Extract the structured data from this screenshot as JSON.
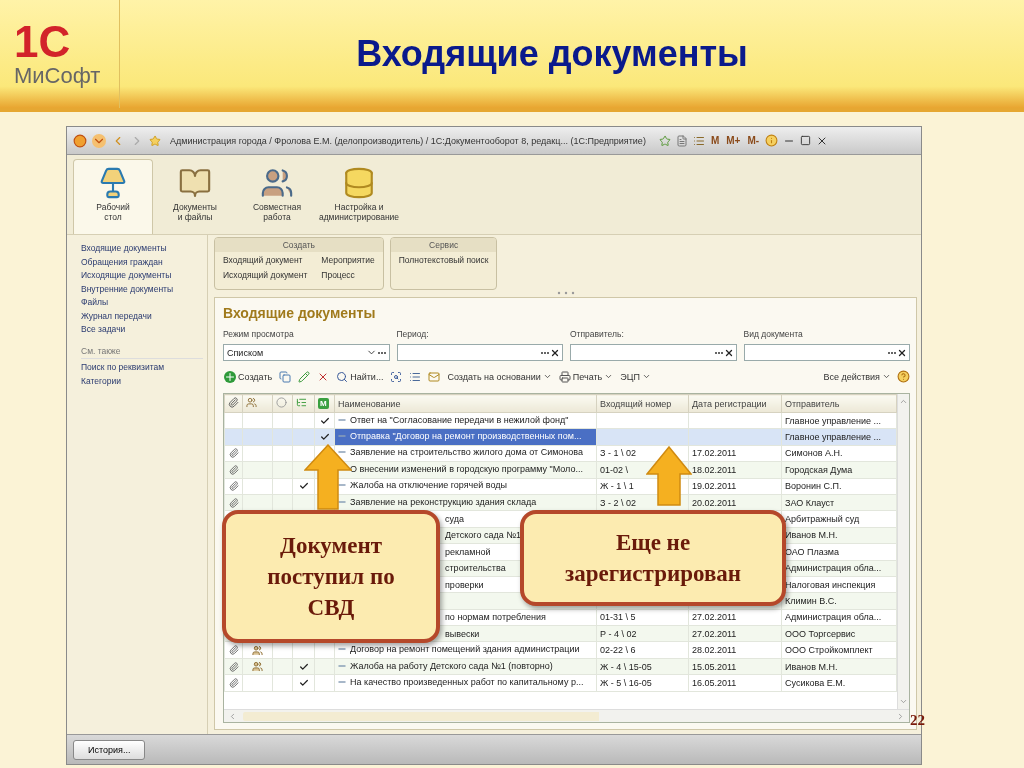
{
  "slide": {
    "logo_mark": "1С",
    "logo_brand": "МиСофт",
    "title": "Входящие документы",
    "page_number": "22"
  },
  "window": {
    "title": "Администрация города / Фролова Е.М. (делопроизводитель) / 1С:Документооборот 8, редакц... (1С:Предприятие)",
    "memory_buttons": [
      "M",
      "M+",
      "M-"
    ]
  },
  "sections": [
    {
      "label": "Рабочий\nстол",
      "kind": "desk",
      "selected": true
    },
    {
      "label": "Документы\nи файлы",
      "kind": "folder",
      "selected": false
    },
    {
      "label": "Совместная\nработа",
      "kind": "people",
      "selected": false
    },
    {
      "label": "Настройка и\nадминистрирование",
      "kind": "database",
      "selected": false
    }
  ],
  "sidebar": {
    "items": [
      "Входящие документы",
      "Обращения граждан",
      "Исходящие документы",
      "Внутренние документы",
      "Файлы",
      "Журнал передачи",
      "Все задачи"
    ],
    "see_also_title": "См. также",
    "see_also": [
      "Поиск по реквизитам",
      "Категории"
    ]
  },
  "command_groups": [
    {
      "title": "Создать",
      "columns": [
        [
          "Входящий документ",
          "Исходящий документ"
        ],
        [
          "Мероприятие",
          "Процесс"
        ]
      ]
    },
    {
      "title": "Сервис",
      "columns": [
        [
          "Полнотекстовый поиск"
        ]
      ]
    }
  ],
  "form": {
    "title": "Входящие документы",
    "filters": [
      {
        "label": "Режим просмотра",
        "value": "Списком",
        "kind": "dropdown"
      },
      {
        "label": "Период:",
        "kind": "choice"
      },
      {
        "label": "Отправитель:",
        "kind": "choice"
      },
      {
        "label": "Вид документа",
        "kind": "choice"
      }
    ],
    "toolbar": [
      {
        "kind": "plus",
        "label": "Создать",
        "dropdown": false
      },
      {
        "kind": "copy",
        "dropdown": false
      },
      {
        "kind": "pencil",
        "dropdown": false
      },
      {
        "kind": "delete",
        "dropdown": false
      },
      {
        "kind": "search",
        "label": "Найти...",
        "dropdown": false
      },
      {
        "kind": "search-list",
        "dropdown": false
      },
      {
        "kind": "list",
        "dropdown": false
      },
      {
        "kind": "mail",
        "dropdown": false
      },
      {
        "kind": "text",
        "label": "Создать на основании",
        "dropdown": true
      },
      {
        "kind": "printer",
        "label": "Печать",
        "dropdown": true
      },
      {
        "kind": "text",
        "label": "ЭЦП",
        "dropdown": true
      }
    ],
    "all_actions": "Все действия",
    "table": {
      "m_header": "M",
      "columns": [
        "Наименование",
        "Входящий номер",
        "Дата регистрации",
        "Отправитель"
      ],
      "rows": [
        {
          "kind": "full",
          "name": "Ответ на \"Согласование передачи в нежилой фонд\"",
          "sender": "Главное управление ...",
          "attached": false,
          "group": false,
          "checked": false,
          "m_checked": true,
          "selected": false
        },
        {
          "kind": "full",
          "name": "Отправка \"Договор на ремонт производственных пом...",
          "sender": "Главное управление ...",
          "attached": false,
          "group": false,
          "checked": false,
          "m_checked": true,
          "selected": true
        },
        {
          "kind": "full",
          "name": "Заявление на строительство жилого дома от Симонова",
          "number": "З - 1 \\ 02",
          "date": "17.02.2011",
          "sender": "Симонов А.Н.",
          "attached": true,
          "group": false,
          "checked": false,
          "selected": false
        },
        {
          "kind": "full",
          "name": "О внесении изменений в городскую программу \"Моло...",
          "number": "01-02 \\",
          "date": "18.02.2011",
          "sender": "Городская Дума",
          "attached": true,
          "group": false,
          "checked": false,
          "selected": false
        },
        {
          "kind": "full",
          "name": "Жалоба на отключение горячей воды",
          "number": "Ж - 1 \\ 1",
          "date": "19.02.2011",
          "sender": "Воронин С.П.",
          "attached": true,
          "group": false,
          "checked": true,
          "selected": false
        },
        {
          "kind": "full",
          "name": "Заявление на реконструкцию здания склада",
          "number": "З - 2 \\ 02",
          "date": "20.02.2011",
          "sender": "ЗАО Клауст",
          "attached": true,
          "group": false,
          "checked": false,
          "selected": false
        },
        {
          "kind": "covered",
          "name": "суда",
          "sender": "Арбитражный суд",
          "selected": false
        },
        {
          "kind": "covered",
          "name": "Детского сада №1",
          "sender": "Иванов М.Н.",
          "selected": false
        },
        {
          "kind": "covered",
          "name": "рекламной",
          "sender": "ОАО Плазма",
          "selected": false
        },
        {
          "kind": "covered",
          "name": "строительства",
          "sender": "Администрация обла...",
          "selected": false
        },
        {
          "kind": "covered",
          "name": "проверки",
          "sender": "Налоговая инспекция",
          "selected": false
        },
        {
          "kind": "covered",
          "sender": "Климин В.С.",
          "selected": false
        },
        {
          "kind": "covered",
          "name": "по нормам потребления",
          "number": "01-31 \\ 5",
          "date": "27.02.2011",
          "sender": "Администрация обла...",
          "selected": false
        },
        {
          "kind": "covered",
          "name": "вывески",
          "number": "Р - 4 \\ 02",
          "date": "27.02.2011",
          "sender": "ООО Торгсервис",
          "selected": false
        },
        {
          "kind": "full",
          "name": "Договор на ремонт помещений здания администрации",
          "number": "02-22 \\ 6",
          "date": "28.02.2011",
          "sender": "ООО Стройкомплект",
          "attached": true,
          "group": true,
          "checked": false,
          "m_checked": false,
          "selected": false
        },
        {
          "kind": "full",
          "name": "Жалоба на работу Детского сада №1 (повторно)",
          "number": "Ж - 4 \\ 15-05",
          "date": "15.05.2011",
          "sender": "Иванов М.Н.",
          "attached": true,
          "group": true,
          "checked": true,
          "m_checked": false,
          "selected": false
        },
        {
          "kind": "full",
          "name": "На качество произведенных работ по капитальному р...",
          "number": "Ж - 5 \\ 16-05",
          "date": "16.05.2011",
          "sender": "Сусикова Е.М.",
          "attached": true,
          "group": false,
          "checked": true,
          "m_checked": false,
          "selected": false
        }
      ]
    }
  },
  "history_button": "История...",
  "callouts": [
    {
      "text": "Документ поступил по СВД"
    },
    {
      "text": "Еще не зарегистрирован"
    }
  ]
}
